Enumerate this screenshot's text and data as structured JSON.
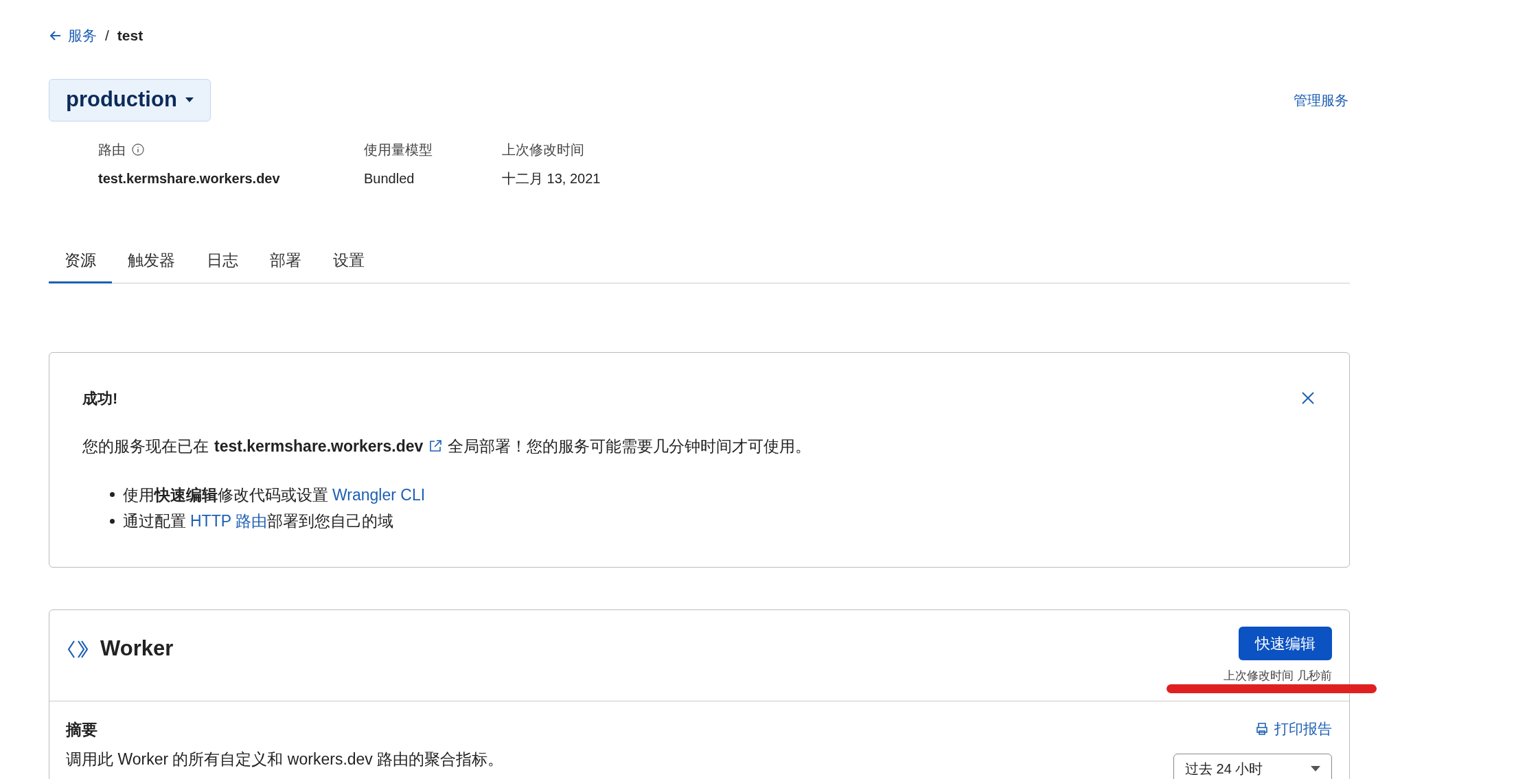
{
  "breadcrumb": {
    "back": "服务",
    "separator": "/",
    "current": "test"
  },
  "environment": {
    "label": "production"
  },
  "manage_link": "管理服务",
  "meta": [
    {
      "label": "路由",
      "value": "test.kermshare.workers.dev",
      "info": true,
      "bold": true
    },
    {
      "label": "使用量模型",
      "value": "Bundled",
      "info": false,
      "bold": false
    },
    {
      "label": "上次修改时间",
      "value": "十二月 13, 2021",
      "info": false,
      "bold": false
    }
  ],
  "tabs": [
    {
      "label": "资源",
      "selected": true
    },
    {
      "label": "触发器",
      "selected": false
    },
    {
      "label": "日志",
      "selected": false
    },
    {
      "label": "部署",
      "selected": false
    },
    {
      "label": "设置",
      "selected": false
    }
  ],
  "alert": {
    "title": "成功!",
    "message_before": "您的服务现在已在",
    "domain": "test.kermshare.workers.dev",
    "message_after": "全局部署！您的服务可能需要几分钟时间才可使用。",
    "bullets": [
      {
        "before": "使用**快速编辑**修改代码或设置",
        "link": "Wrangler CLI"
      },
      {
        "before": "通过配置",
        "link": "HTTP 路由",
        "after": "部署到您自己的域"
      }
    ]
  },
  "worker": {
    "title": "Worker",
    "quick_edit": "快速编辑",
    "last_modified": "上次修改时间 几秒前",
    "highlighted": true,
    "summary_title": "摘要",
    "summary_text": "调用此 Worker 的所有自定义和 workers.dev 路由的聚合指标。",
    "print_report": "打印报告",
    "range": "过去 24 小时"
  }
}
